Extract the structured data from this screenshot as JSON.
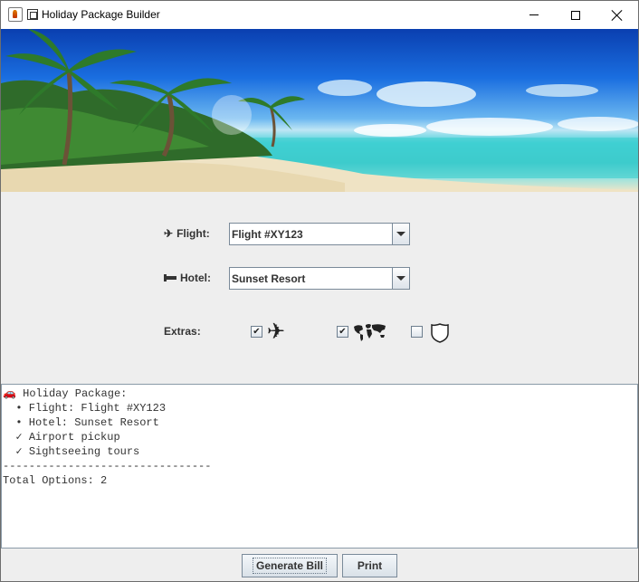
{
  "window": {
    "title": "Holiday Package Builder"
  },
  "form": {
    "flight_label": "Flight:",
    "flight_value": "Flight #XY123",
    "hotel_label": "Hotel:",
    "hotel_value": "Sunset Resort",
    "extras_label": "Extras:",
    "extras": [
      {
        "icon": "airplane-icon",
        "checked": true,
        "mark": "✔"
      },
      {
        "icon": "world-map-icon",
        "checked": true,
        "mark": "✔"
      },
      {
        "icon": "shield-icon",
        "checked": false,
        "mark": ""
      }
    ]
  },
  "summary": {
    "lines": [
      "🚗 Holiday Package:",
      "  • Flight: Flight #XY123",
      "  • Hotel: Sunset Resort",
      "  ✓ Airport pickup",
      "  ✓ Sightseeing tours",
      "--------------------------------",
      "Total Options: 2"
    ]
  },
  "buttons": {
    "generate_bill": "Generate Bill",
    "print": "Print"
  },
  "colors": {
    "window_bg": "#eeeeee",
    "button_border": "#7a8a99"
  }
}
